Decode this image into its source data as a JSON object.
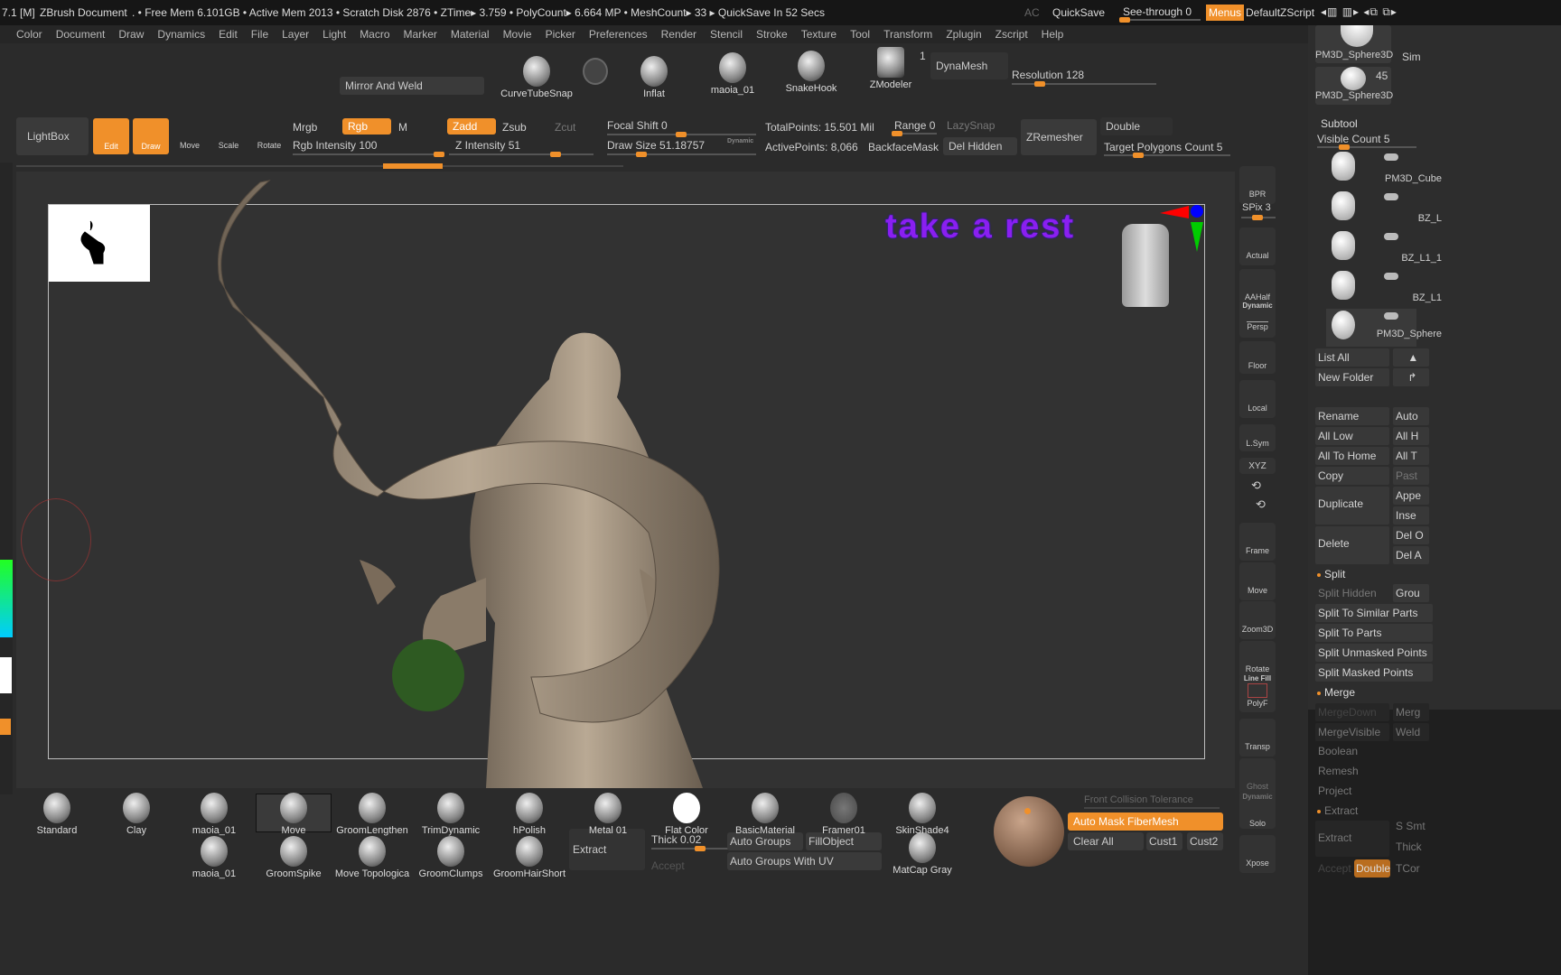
{
  "titlebar": {
    "version": "7.1 [M]",
    "doc": "ZBrush Document",
    "stats": ". • Free Mem 6.101GB • Active Mem 2013 • Scratch Disk 2876 •  ZTime▸ 3.759 • PolyCount▸ 6.664 MP  • MeshCount▸ 33  ▸ QuickSave In 52 Secs",
    "ac": "AC",
    "quicksave": "QuickSave",
    "see_through": "See-through  0",
    "menus": "Menus",
    "script": "DefaultZScript"
  },
  "menus": [
    "Color",
    "Document",
    "Draw",
    "Dynamics",
    "Edit",
    "File",
    "Layer",
    "Light",
    "Macro",
    "Marker",
    "Material",
    "Movie",
    "Picker",
    "Preferences",
    "Render",
    "Stencil",
    "Stroke",
    "Texture",
    "Tool",
    "Transform",
    "Zplugin",
    "Zscript",
    "Help"
  ],
  "topshelf": {
    "mirror": "Mirror And Weld",
    "brushes": [
      "CurveTubeSnap",
      "Inflat",
      "maoia_01",
      "SnakeHook",
      "ZModeler"
    ],
    "zmodeler_count": "1",
    "dynamesh": "DynaMesh",
    "resolution": "Resolution 128"
  },
  "toolbar": {
    "lightbox": "LightBox",
    "edit": "Edit",
    "draw": "Draw",
    "move": "Move",
    "scale": "Scale",
    "rotate": "Rotate",
    "mrgb": "Mrgb",
    "rgb": "Rgb",
    "m": "M",
    "rgb_intensity": "Rgb Intensity 100",
    "zadd": "Zadd",
    "zsub": "Zsub",
    "zcut": "Zcut",
    "z_intensity": "Z Intensity 51",
    "focal_shift": "Focal Shift 0",
    "draw_size": "Draw Size 51.18757",
    "dynamic": "Dynamic",
    "total_points": "TotalPoints: 15.501 Mil",
    "active_points": "ActivePoints: 8,066",
    "range": "Range 0",
    "lazysnap": "LazySnap",
    "backface": "BackfaceMask",
    "del_hidden": "Del Hidden",
    "zremesher": "ZRemesher",
    "double": "Double",
    "target_poly": "Target Polygons Count 5"
  },
  "canvas": {
    "overlay_text": "take a rest",
    "overlay_color": "#8a1ff0"
  },
  "rightcol": {
    "bpr": "BPR",
    "spix": "SPix 3",
    "actual": "Actual",
    "aahalf": "AAHalf",
    "dynamic": "Dynamic",
    "persp": "Persp",
    "floor": "Floor",
    "local": "Local",
    "lsym": "L.Sym",
    "xyz": "XYZ",
    "frame": "Frame",
    "move": "Move",
    "zoom3d": "Zoom3D",
    "rotate": "Rotate",
    "linefill": "Line Fill",
    "polyf": "PolyF",
    "transp": "Transp",
    "ghost": "Ghost",
    "solo": "Solo",
    "xpose": "Xpose"
  },
  "panel": {
    "tool_thumbs": [
      "PM3D_Sphere3D",
      "PM3D_Sphere3D"
    ],
    "thumb_count": "45",
    "sim": "Sim",
    "subtool": "Subtool",
    "visible_count": "Visible Count 5",
    "subtools": [
      "PM3D_Cube",
      "BZ_L",
      "BZ_L1_1",
      "BZ_L1",
      "PM3D_Sphere"
    ],
    "list_all": "List All",
    "new_folder": "New Folder",
    "rename": "Rename",
    "auto": "Auto",
    "all_low": "All Low",
    "all_high": "All H",
    "all_to_home": "All To Home",
    "all_t": "All T",
    "copy": "Copy",
    "paste": "Past",
    "duplicate": "Duplicate",
    "append": "Appe",
    "insert": "Inse",
    "delete": "Delete",
    "del_o": "Del O",
    "del_a": "Del A",
    "split": "Split",
    "split_hidden": "Split Hidden",
    "groups": "Grou",
    "split_similar": "Split To Similar Parts",
    "split_parts": "Split To Parts",
    "split_unmasked": "Split Unmasked Points",
    "split_masked": "Split Masked Points",
    "merge": "Merge",
    "merge_down": "MergeDown",
    "merge_similar": "Merg",
    "merge_visible": "MergeVisible",
    "weld": "Weld",
    "boolean": "Boolean",
    "remesh": "Remesh",
    "project": "Project",
    "extract_h": "Extract",
    "extract": "Extract",
    "s_smt": "S Smt",
    "thick": "Thick",
    "accept": "Accept",
    "double": "Double",
    "tcorner": "TCor"
  },
  "bottom": {
    "row1": [
      "Standard",
      "Clay",
      "maoia_01",
      "Move",
      "GroomLengthen",
      "TrimDynamic",
      "hPolish",
      "Metal 01",
      "Flat Color",
      "BasicMaterial",
      "Framer01",
      "SkinShade4"
    ],
    "row2": [
      "maoia_01",
      "GroomSpike",
      "Move Topologica",
      "GroomClumps",
      "GroomHairShort",
      "MatCap Gray"
    ],
    "extract": "Extract",
    "thick": "Thick 0.02",
    "accept": "Accept",
    "auto_groups": "Auto Groups",
    "fill_object": "FillObject",
    "auto_groups_uv": "Auto Groups With UV",
    "front_collision": "Front Collision Tolerance",
    "auto_mask": "Auto Mask FiberMesh",
    "clear_all": "Clear All",
    "cust1": "Cust1",
    "cust2": "Cust2"
  },
  "colors": {
    "accent": "#f0902a",
    "background": "#2b2b2b",
    "canvas": "#323232"
  }
}
